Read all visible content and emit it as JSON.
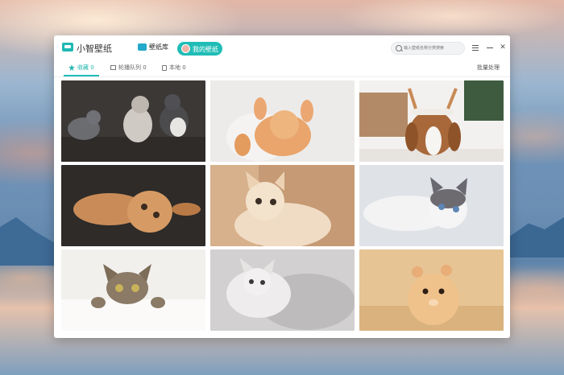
{
  "app": {
    "title": "小智壁纸"
  },
  "nav": {
    "library_label": "壁纸库",
    "mine_label": "我的壁纸"
  },
  "search": {
    "placeholder": "输入壁纸名称分类搜索"
  },
  "tabs": [
    {
      "label": "收藏",
      "count": "0",
      "icon": "star-icon",
      "active": true
    },
    {
      "label": "轮播队列",
      "count": "0",
      "icon": "play-icon",
      "active": false
    },
    {
      "label": "本地",
      "count": "0",
      "icon": "file-icon",
      "active": false
    }
  ],
  "batch_label": "批量处理",
  "wallpapers": [
    {
      "subject": "three kittens",
      "tone": "#3a3634"
    },
    {
      "subject": "ginger kitten lying on back",
      "tone": "#e9e7e6"
    },
    {
      "subject": "beagle with reindeer antlers",
      "tone": "#f2f0ee"
    },
    {
      "subject": "fluffy ginger cat",
      "tone": "#2f2c2a"
    },
    {
      "subject": "cream kitten",
      "tone": "#c89a72"
    },
    {
      "subject": "ragdoll cat",
      "tone": "#e4e6ea"
    },
    {
      "subject": "tabby cat peeking",
      "tone": "#f1efec"
    },
    {
      "subject": "cat on blanket",
      "tone": "#d6d4d3"
    },
    {
      "subject": "hamster in wood shavings",
      "tone": "#e8c79c"
    }
  ],
  "colors": {
    "accent": "#20bdb6"
  }
}
